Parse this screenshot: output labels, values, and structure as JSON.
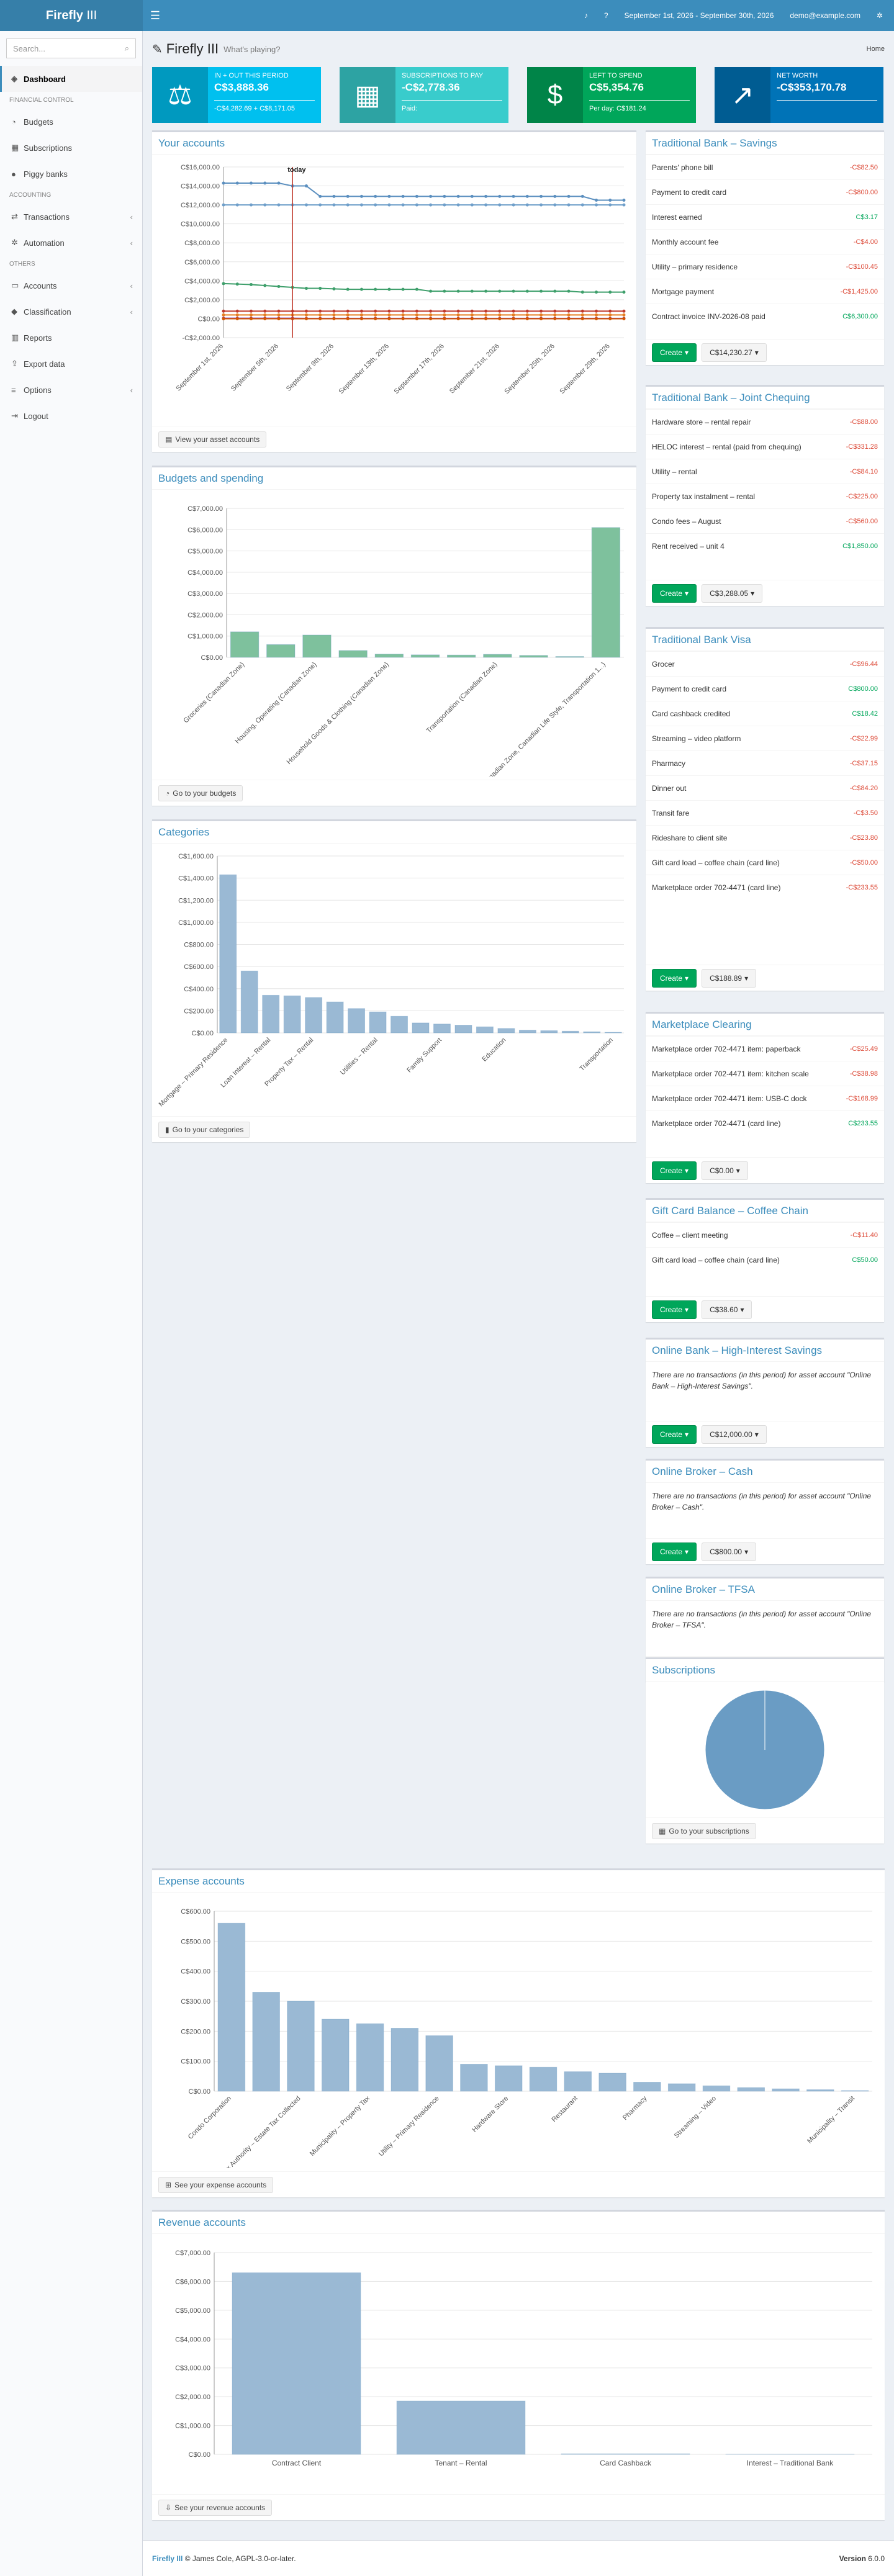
{
  "app": {
    "name_bold": "Firefly",
    "name_light": "III",
    "date_range": "September 1st, 2026 - September 30th, 2026",
    "user_email": "demo@example.com"
  },
  "page": {
    "title": "Firefly III",
    "subtitle": "What's playing?",
    "breadcrumb": "Home"
  },
  "sidebar": {
    "search_placeholder": "Search...",
    "items": [
      {
        "label": "Dashboard",
        "icon": "dashboard-icon",
        "glyph": "◈"
      },
      {
        "heading": "Financial control"
      },
      {
        "label": "Budgets",
        "icon": "pie-chart-icon",
        "glyph": "◔"
      },
      {
        "label": "Subscriptions",
        "icon": "calendar-icon",
        "glyph": "▦"
      },
      {
        "label": "Piggy banks",
        "icon": "piggy-bank-icon",
        "glyph": "●"
      },
      {
        "heading": "Accounting"
      },
      {
        "label": "Transactions",
        "icon": "transfer-icon",
        "glyph": "⇄"
      },
      {
        "label": "Automation",
        "icon": "gear-icon",
        "glyph": "✲"
      },
      {
        "heading": "Others"
      },
      {
        "label": "Accounts",
        "icon": "credit-card-icon",
        "glyph": "▭"
      },
      {
        "label": "Classification",
        "icon": "tag-icon",
        "glyph": "◆"
      },
      {
        "label": "Reports",
        "icon": "bar-chart-icon",
        "glyph": "▥"
      },
      {
        "label": "Export data",
        "icon": "export-icon",
        "glyph": "⇪"
      },
      {
        "label": "Options",
        "icon": "sliders-icon",
        "glyph": "≡"
      },
      {
        "label": "Logout",
        "icon": "logout-icon",
        "glyph": "⇥"
      }
    ]
  },
  "infoboxes": [
    {
      "label": "In + out this period",
      "value": "C$3,888.36",
      "desc": "-C$4,282.69 + C$8,171.05",
      "color": "#00c0ef",
      "icon": "scale-icon",
      "glyph": "⚖"
    },
    {
      "label": "Subscriptions to pay",
      "value": "-C$2,778.36",
      "desc": "Paid:",
      "color": "#39cccc",
      "icon": "calendar-icon",
      "glyph": "▦"
    },
    {
      "label": "Left to spend",
      "value": "C$5,354.76",
      "desc": "Per day: C$181.24",
      "color": "#00a65a",
      "icon": "money-icon",
      "glyph": "$"
    },
    {
      "label": "Net worth",
      "value": "-C$353,170.78",
      "desc": "",
      "color": "#0073b7",
      "icon": "line-chart-icon",
      "glyph": "↗"
    }
  ],
  "boxes": {
    "accounts": {
      "title": "Your accounts",
      "footer": "View your asset accounts"
    },
    "budgets": {
      "title": "Budgets and spending",
      "footer": "Go to your budgets"
    },
    "categories": {
      "title": "Categories",
      "footer": "Go to your categories"
    },
    "subscriptions": {
      "title": "Subscriptions",
      "footer": "Go to your subscriptions"
    },
    "expense": {
      "title": "Expense accounts",
      "footer": "See your expense accounts"
    },
    "revenue": {
      "title": "Revenue accounts",
      "footer": "See your revenue accounts"
    }
  },
  "create_label": "Create",
  "account_boxes": [
    {
      "title": "Traditional Bank – Savings",
      "balance": "C$14,230.27",
      "tx": [
        {
          "d": "Parents' phone bill",
          "a": "-C$82.50",
          "neg": true
        },
        {
          "d": "Payment to credit card",
          "a": "-C$800.00",
          "neg": true
        },
        {
          "d": "Interest earned",
          "a": "C$3.17",
          "neg": false
        },
        {
          "d": "Monthly account fee",
          "a": "-C$4.00",
          "neg": true
        },
        {
          "d": "Utility – primary residence",
          "a": "-C$100.45",
          "neg": true
        },
        {
          "d": "Mortgage payment",
          "a": "-C$1,425.00",
          "neg": true
        },
        {
          "d": "Contract invoice INV-2026-08 paid",
          "a": "C$6,300.00",
          "neg": false
        }
      ]
    },
    {
      "title": "Traditional Bank – Joint Chequing",
      "balance": "C$3,288.05",
      "tx": [
        {
          "d": "Hardware store – rental repair",
          "a": "-C$88.00",
          "neg": true
        },
        {
          "d": "HELOC interest – rental (paid from chequing)",
          "a": "-C$331.28",
          "neg": true
        },
        {
          "d": "Utility – rental",
          "a": "-C$84.10",
          "neg": true
        },
        {
          "d": "Property tax instalment – rental",
          "a": "-C$225.00",
          "neg": true
        },
        {
          "d": "Condo fees – August",
          "a": "-C$560.00",
          "neg": true
        },
        {
          "d": "Rent received – unit 4",
          "a": "C$1,850.00",
          "neg": false
        }
      ]
    },
    {
      "title": "Traditional Bank Visa",
      "balance": "C$188.89",
      "tx": [
        {
          "d": "Grocer",
          "a": "-C$96.44",
          "neg": true
        },
        {
          "d": "Payment to credit card",
          "a": "C$800.00",
          "neg": false
        },
        {
          "d": "Card cashback credited",
          "a": "C$18.42",
          "neg": false
        },
        {
          "d": "Streaming – video platform",
          "a": "-C$22.99",
          "neg": true
        },
        {
          "d": "Pharmacy",
          "a": "-C$37.15",
          "neg": true
        },
        {
          "d": "Dinner out",
          "a": "-C$84.20",
          "neg": true
        },
        {
          "d": "Transit fare",
          "a": "-C$3.50",
          "neg": true
        },
        {
          "d": "Rideshare to client site",
          "a": "-C$23.80",
          "neg": true
        },
        {
          "d": "Gift card load – coffee chain (card line)",
          "a": "-C$50.00",
          "neg": true
        },
        {
          "d": "Marketplace order 702-4471 (card line)",
          "a": "-C$233.55",
          "neg": true
        }
      ]
    },
    {
      "title": "Marketplace Clearing",
      "balance": "C$0.00",
      "tx": [
        {
          "d": "Marketplace order 702-4471 item: paperback",
          "a": "-C$25.49",
          "neg": true
        },
        {
          "d": "Marketplace order 702-4471 item: kitchen scale",
          "a": "-C$38.98",
          "neg": true
        },
        {
          "d": "Marketplace order 702-4471 item: USB-C dock",
          "a": "-C$168.99",
          "neg": true
        },
        {
          "d": "Marketplace order 702-4471 (card line)",
          "a": "C$233.55",
          "neg": false
        }
      ]
    },
    {
      "title": "Gift Card Balance – Coffee Chain",
      "balance": "C$38.60",
      "tx": [
        {
          "d": "Coffee – client meeting",
          "a": "-C$11.40",
          "neg": true
        },
        {
          "d": "Gift card load – coffee chain (card line)",
          "a": "C$50.00",
          "neg": false
        }
      ]
    },
    {
      "title": "Online Bank – High-Interest Savings",
      "balance": "C$12,000.00",
      "empty": "There are no transactions (in this period) for asset account \"Online Bank – High-Interest Savings\".",
      "tx": []
    },
    {
      "title": "Online Broker – Cash",
      "balance": "C$800.00",
      "empty": "There are no transactions (in this period) for asset account \"Online Broker – Cash\".",
      "tx": []
    },
    {
      "title": "Online Broker – TFSA",
      "balance": "C$0.00",
      "empty": "There are no transactions (in this period) for asset account \"Online Broker – TFSA\".",
      "tx": []
    }
  ],
  "charts": {
    "accounts": {
      "type": "line",
      "ylim": [
        -2000,
        16000
      ],
      "yticks": [
        -2000,
        0,
        2000,
        4000,
        6000,
        8000,
        10000,
        12000,
        14000,
        16000
      ],
      "ytick_labels": [
        "-C$2,000.00",
        "C$0.00",
        "C$2,000.00",
        "C$4,000.00",
        "C$6,000.00",
        "C$8,000.00",
        "C$10,000.00",
        "C$12,000.00",
        "C$14,000.00",
        "C$16,000.00"
      ],
      "x_labels": [
        "September 1st, 2026",
        "September 5th, 2026",
        "September 9th, 2026",
        "September 13th, 2026",
        "September 17th, 2026",
        "September 21st, 2026",
        "September 25th, 2026",
        "September 29th, 2026"
      ],
      "days": 30,
      "today_day": 6,
      "today_label": "today",
      "series": [
        {
          "color": "#5b8fbf",
          "values": [
            14300,
            14300,
            14300,
            14300,
            14300,
            14000,
            14000,
            12900,
            12900,
            12900,
            12900,
            12900,
            12900,
            12900,
            12900,
            12900,
            12900,
            12900,
            12900,
            12900,
            12900,
            12900,
            12900,
            12900,
            12900,
            12900,
            12900,
            12500,
            12500,
            12500
          ]
        },
        {
          "color": "#6f9fca",
          "values": [
            12000,
            12000,
            12000,
            12000,
            12000,
            12000,
            12000,
            12000,
            12000,
            12000,
            12000,
            12000,
            12000,
            12000,
            12000,
            12000,
            12000,
            12000,
            12000,
            12000,
            12000,
            12000,
            12000,
            12000,
            12000,
            12000,
            12000,
            12000,
            12000,
            12000
          ]
        },
        {
          "color": "#3e9f6b",
          "values": [
            3700,
            3650,
            3600,
            3500,
            3400,
            3300,
            3200,
            3200,
            3150,
            3100,
            3100,
            3100,
            3100,
            3100,
            3100,
            2900,
            2900,
            2900,
            2900,
            2900,
            2900,
            2900,
            2900,
            2900,
            2900,
            2900,
            2800,
            2800,
            2800,
            2800
          ]
        },
        {
          "color": "#c0392b",
          "values": [
            800,
            800,
            800,
            800,
            800,
            800,
            800,
            800,
            800,
            800,
            800,
            800,
            800,
            800,
            800,
            800,
            800,
            800,
            800,
            800,
            800,
            800,
            800,
            800,
            800,
            800,
            800,
            800,
            800,
            800
          ]
        },
        {
          "color": "#e67e22",
          "values": [
            400,
            400,
            400,
            400,
            400,
            400,
            400,
            400,
            400,
            400,
            400,
            400,
            400,
            400,
            400,
            400,
            400,
            400,
            400,
            400,
            400,
            400,
            400,
            400,
            400,
            400,
            400,
            400,
            400,
            400
          ]
        },
        {
          "color": "#8e44ad",
          "values": [
            50,
            50,
            50,
            50,
            50,
            50,
            40,
            40,
            40,
            40,
            40,
            40,
            40,
            40,
            40,
            40,
            40,
            40,
            40,
            40,
            40,
            40,
            40,
            40,
            40,
            40,
            40,
            40,
            40,
            40
          ]
        },
        {
          "color": "#d35400",
          "values": [
            0,
            0,
            0,
            0,
            0,
            0,
            0,
            0,
            0,
            0,
            0,
            0,
            0,
            0,
            0,
            0,
            0,
            0,
            0,
            0,
            0,
            0,
            0,
            0,
            0,
            0,
            0,
            0,
            0,
            0
          ]
        }
      ]
    },
    "budgets": {
      "type": "bar",
      "ylim": [
        0,
        7000
      ],
      "yticks": [
        0,
        1000,
        2000,
        3000,
        4000,
        5000,
        6000,
        7000
      ],
      "ytick_labels": [
        "C$0.00",
        "C$1,000.00",
        "C$2,000.00",
        "C$3,000.00",
        "C$4,000.00",
        "C$5,000.00",
        "C$6,000.00",
        "C$7,000.00"
      ],
      "categories": [
        "Groceries (Canadian Zone)",
        "",
        "Housing, Operating (Canadian Zone)",
        "",
        "Household Goods & Clothing (Canadian Zone)",
        "",
        "",
        "Transportation (Canadian Zone)",
        "",
        "",
        "Education & Transportation (Canadian Zone, Canadian Life Style, Transportation 1...)"
      ],
      "values": [
        1200,
        600,
        1050,
        320,
        150,
        120,
        110,
        140,
        90,
        40,
        6100
      ],
      "color": "#7ec19d"
    },
    "categories": {
      "type": "bar",
      "ylim": [
        0,
        1600
      ],
      "yticks": [
        0,
        200,
        400,
        600,
        800,
        1000,
        1200,
        1400,
        1600
      ],
      "ytick_labels": [
        "C$0.00",
        "C$200.00",
        "C$400.00",
        "C$600.00",
        "C$800.00",
        "C$1,000.00",
        "C$1,200.00",
        "C$1,400.00",
        "C$1,600.00"
      ],
      "categories": [
        "Mortgage – Primary Residence",
        "",
        "Loan Interest – Rental",
        "",
        "Property Tax – Rental",
        "",
        "",
        "Utilities – Rental",
        "",
        "",
        "Family Support",
        "",
        "",
        "Education",
        "",
        "",
        "",
        "",
        "Transportation"
      ],
      "values": [
        1430,
        560,
        340,
        335,
        320,
        280,
        220,
        190,
        150,
        90,
        80,
        70,
        55,
        40,
        25,
        20,
        15,
        10,
        5
      ],
      "color": "#9ab9d4"
    },
    "subscriptions": {
      "type": "pie",
      "values": [
        100
      ],
      "color": "#6a9cc4"
    },
    "expense": {
      "type": "bar",
      "ylim": [
        0,
        600
      ],
      "yticks": [
        0,
        100,
        200,
        300,
        400,
        500,
        600
      ],
      "ytick_labels": [
        "C$0.00",
        "C$100.00",
        "C$200.00",
        "C$300.00",
        "C$400.00",
        "C$500.00",
        "C$600.00"
      ],
      "categories": [
        "Condo Corporation",
        "",
        "Tax Authority – Estate Tax Collected",
        "",
        "Municipality – Property Tax",
        "",
        "Utility – Primary Residence",
        "",
        "Hardware Store",
        "",
        "Restaurant",
        "",
        "Pharmacy",
        "",
        "Streaming – Video",
        "",
        "",
        "",
        "Municipality – Transit"
      ],
      "values": [
        560,
        330,
        300,
        240,
        225,
        210,
        185,
        90,
        85,
        80,
        65,
        60,
        30,
        25,
        18,
        12,
        8,
        5,
        2
      ],
      "color": "#9ab9d4"
    },
    "revenue": {
      "type": "bar",
      "ylim": [
        0,
        7000
      ],
      "yticks": [
        0,
        1000,
        2000,
        3000,
        4000,
        5000,
        6000,
        7000
      ],
      "ytick_labels": [
        "C$0.00",
        "C$1,000.00",
        "C$2,000.00",
        "C$3,000.00",
        "C$4,000.00",
        "C$5,000.00",
        "C$6,000.00",
        "C$7,000.00"
      ],
      "categories": [
        "Contract Client",
        "Tenant – Rental",
        "Card Cashback",
        "Interest – Traditional Bank"
      ],
      "values": [
        6300,
        1850,
        18.42,
        3.17
      ],
      "color": "#9ab9d4"
    }
  },
  "footer": {
    "app": "Firefly III",
    "rest": "© James Cole, AGPL-3.0-or-later.",
    "version_label": "Version",
    "version": "6.0.0"
  }
}
